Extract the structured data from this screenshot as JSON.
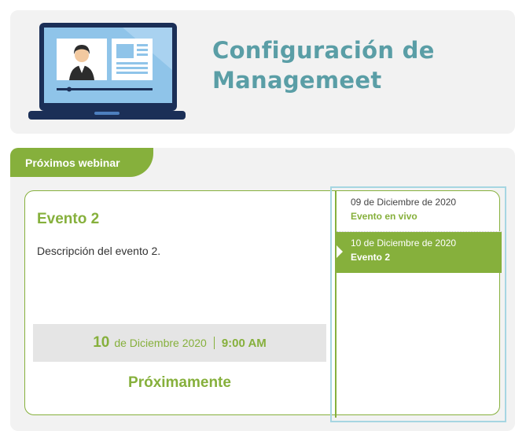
{
  "header": {
    "title": "Configuración de Managemeet"
  },
  "section": {
    "tab_label": "Próximos webinar"
  },
  "event": {
    "title": "Evento 2",
    "description": "Descripción del evento 2.",
    "date_day": "10",
    "date_month": "de Diciembre 2020",
    "time": "9:00 AM",
    "status": "Próximamente"
  },
  "event_list": [
    {
      "date": "09 de Diciembre de 2020",
      "name": "Evento en vivo",
      "selected": false
    },
    {
      "date": "10 de Diciembre de 2020",
      "name": "Evento 2",
      "selected": true
    }
  ],
  "colors": {
    "accent_green": "#86b03c",
    "title_teal": "#5a9ea6",
    "panel_bg": "#f2f2f2",
    "list_border_blue": "#a6d6e2",
    "laptop_navy": "#1b2f57"
  },
  "icons": {
    "laptop": "laptop-webinar-icon"
  }
}
